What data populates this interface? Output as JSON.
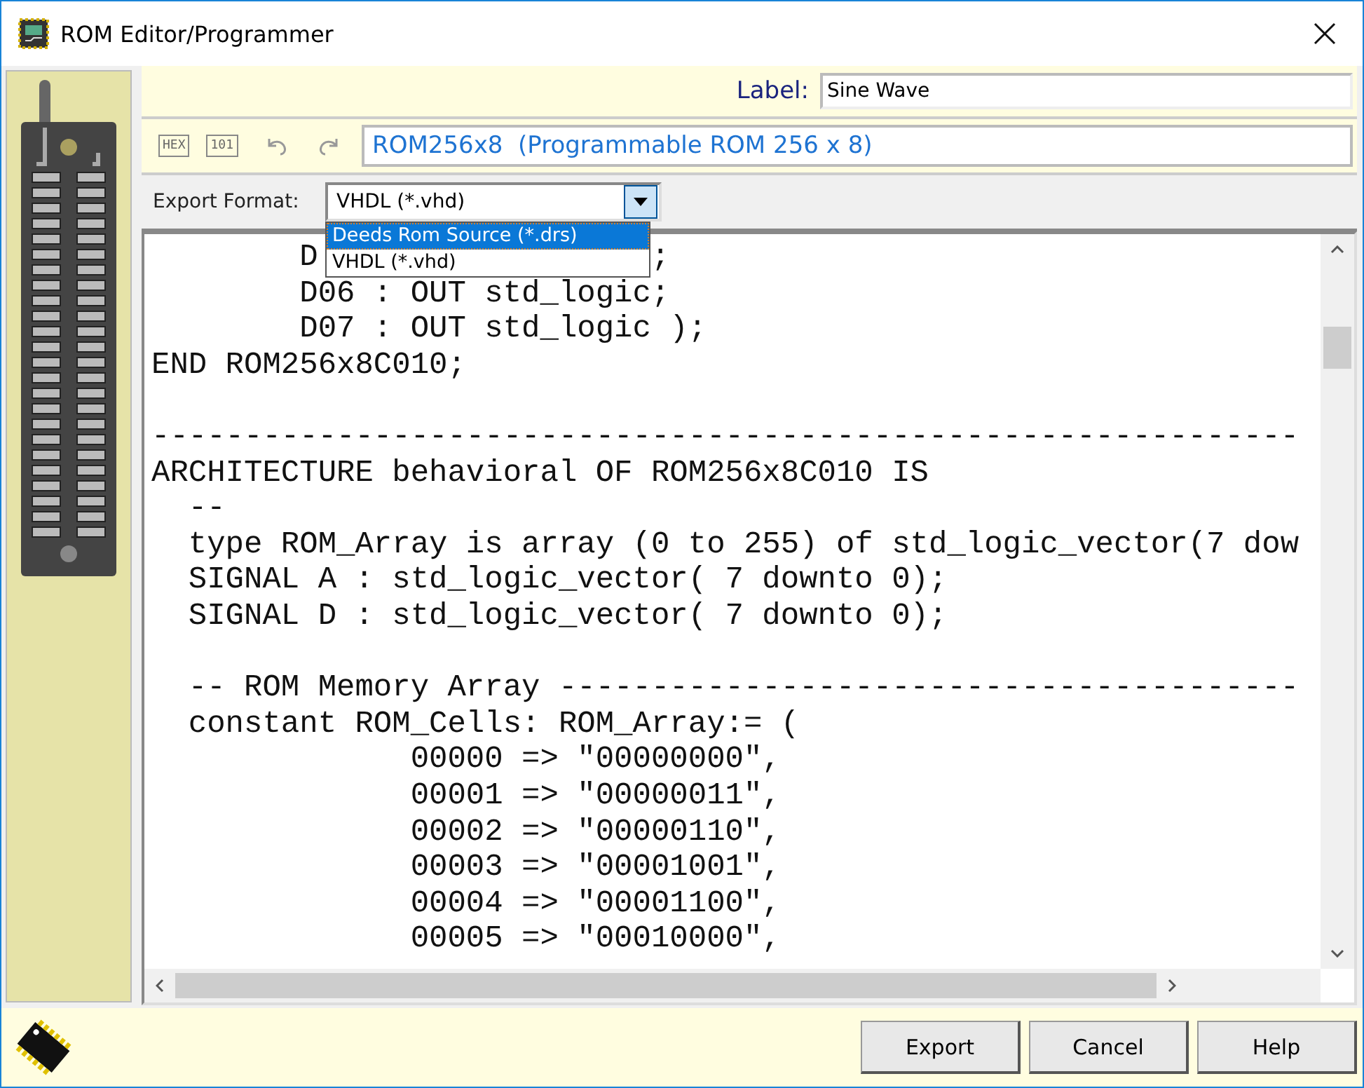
{
  "window": {
    "title": "ROM Editor/Programmer"
  },
  "label": {
    "caption": "Label:",
    "value": "Sine Wave"
  },
  "toolbar": {
    "buttons": [
      "HEX",
      "101"
    ],
    "description": "ROM256x8  (Programmable ROM 256 x 8)"
  },
  "export_format": {
    "caption": "Export Format:",
    "value": "VHDL (*.vhd)",
    "expanded": true,
    "options": [
      {
        "label": "Deeds Rom Source (*.drs)",
        "highlighted": true
      },
      {
        "label": "VHDL (*.vhd)",
        "highlighted": false
      }
    ]
  },
  "code_lines": [
    {
      "kind": "split",
      "parts": [
        "        D",
        ";"
      ]
    },
    {
      "kind": "code",
      "text": "        D06 : OUT std_logic;"
    },
    {
      "kind": "code",
      "text": "        D07 : OUT std_logic );"
    },
    {
      "kind": "code",
      "text": "END ROM256x8C010;"
    },
    {
      "kind": "blank"
    },
    {
      "kind": "code",
      "text": "--------------------------------------------------------------"
    },
    {
      "kind": "code",
      "text": "ARCHITECTURE behavioral OF ROM256x8C010 IS"
    },
    {
      "kind": "code",
      "text": "  --"
    },
    {
      "kind": "code",
      "text": "  type ROM_Array is array (0 to 255) of std_logic_vector(7 dow"
    },
    {
      "kind": "code",
      "text": "  SIGNAL A : std_logic_vector( 7 downto 0);"
    },
    {
      "kind": "code",
      "text": "  SIGNAL D : std_logic_vector( 7 downto 0);"
    },
    {
      "kind": "blank"
    },
    {
      "kind": "code",
      "text": "  -- ROM Memory Array ----------------------------------------"
    },
    {
      "kind": "code",
      "text": "  constant ROM_Cells: ROM_Array:= ("
    },
    {
      "kind": "code",
      "text": "              00000 => \"00000000\","
    },
    {
      "kind": "code",
      "text": "              00001 => \"00000011\","
    },
    {
      "kind": "code",
      "text": "              00002 => \"00000110\","
    },
    {
      "kind": "code",
      "text": "              00003 => \"00001001\","
    },
    {
      "kind": "code",
      "text": "              00004 => \"00001100\","
    },
    {
      "kind": "code",
      "text": "              00005 => \"00010000\","
    }
  ],
  "buttons": [
    "Export",
    "Cancel",
    "Help"
  ]
}
